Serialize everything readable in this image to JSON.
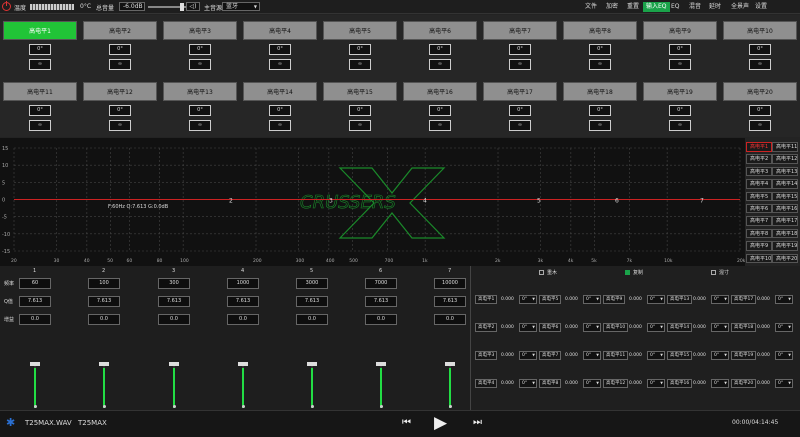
{
  "topbar": {
    "temp_label": "温度",
    "temp_value": "0°C",
    "volume_label": "总音量",
    "volume_value": "-6.0dB",
    "mute_label": "◁)",
    "source_label": "主音源",
    "source_value": "蓝牙",
    "menu": [
      "文件",
      "加密",
      "重置",
      "输入EQ",
      "EQ",
      "混音",
      "延时",
      "全景声",
      "设置"
    ],
    "active_menu": 3
  },
  "channels": [
    {
      "name": "高电平1",
      "phase": "0°",
      "link": "∞"
    },
    {
      "name": "高电平2",
      "phase": "0°",
      "link": "∞"
    },
    {
      "name": "高电平3",
      "phase": "0°",
      "link": "∞"
    },
    {
      "name": "高电平4",
      "phase": "0°",
      "link": "∞"
    },
    {
      "name": "高电平5",
      "phase": "0°",
      "link": "∞"
    },
    {
      "name": "高电平6",
      "phase": "0°",
      "link": "∞"
    },
    {
      "name": "高电平7",
      "phase": "0°",
      "link": "∞"
    },
    {
      "name": "高电平8",
      "phase": "0°",
      "link": "∞"
    },
    {
      "name": "高电平9",
      "phase": "0°",
      "link": "∞"
    },
    {
      "name": "高电平10",
      "phase": "0°",
      "link": "∞"
    },
    {
      "name": "高电平11",
      "phase": "0°",
      "link": "∞"
    },
    {
      "name": "高电平12",
      "phase": "0°",
      "link": "∞"
    },
    {
      "name": "高电平13",
      "phase": "0°",
      "link": "∞"
    },
    {
      "name": "高电平14",
      "phase": "0°",
      "link": "∞"
    },
    {
      "name": "高电平15",
      "phase": "0°",
      "link": "∞"
    },
    {
      "name": "高电平16",
      "phase": "0°",
      "link": "∞"
    },
    {
      "name": "高电平17",
      "phase": "0°",
      "link": "∞"
    },
    {
      "name": "高电平18",
      "phase": "0°",
      "link": "∞"
    },
    {
      "name": "高电平19",
      "phase": "0°",
      "link": "∞"
    },
    {
      "name": "高电平20",
      "phase": "0°",
      "link": "∞"
    }
  ],
  "graph": {
    "y_ticks": [
      "15",
      "10",
      "5",
      "0",
      "-5",
      "-10",
      "-15"
    ],
    "x_ticks": [
      "20",
      "30",
      "40",
      "50",
      "60",
      "80",
      "100",
      "200",
      "300",
      "400",
      "500",
      "700",
      "1k",
      "2k",
      "3k",
      "4k",
      "5k",
      "7k",
      "10k",
      "20k"
    ],
    "annotation": "F:60Hz Q:7.613 G:0.0dB",
    "point_labels": [
      "2",
      "3",
      "4",
      "5",
      "6",
      "7"
    ],
    "logo": "CRUSSERS",
    "curve_color": "#cc2222"
  },
  "right_list": [
    "高电平1",
    "高电平11",
    "高电平2",
    "高电平12",
    "高电平3",
    "高电平13",
    "高电平4",
    "高电平14",
    "高电平5",
    "高电平15",
    "高电平6",
    "高电平16",
    "高电平7",
    "高电平17",
    "高电平8",
    "高电平18",
    "高电平9",
    "高电平19",
    "高电平10",
    "高电平20"
  ],
  "bands": {
    "row_labels": [
      "频率",
      "Q值",
      "增益"
    ],
    "items": [
      {
        "num": "1",
        "freq": "60",
        "q": "7.613",
        "gain": "0.0"
      },
      {
        "num": "2",
        "freq": "100",
        "q": "7.613",
        "gain": "0.0"
      },
      {
        "num": "3",
        "freq": "300",
        "q": "7.613",
        "gain": "0.0"
      },
      {
        "num": "4",
        "freq": "1000",
        "q": "7.613",
        "gain": "0.0"
      },
      {
        "num": "5",
        "freq": "3000",
        "q": "7.613",
        "gain": "0.0"
      },
      {
        "num": "6",
        "freq": "7000",
        "q": "7.613",
        "gain": "0.0"
      },
      {
        "num": "7",
        "freq": "10000",
        "q": "7.613",
        "gain": "0.0"
      }
    ]
  },
  "mix": {
    "options": [
      "重木",
      "复制",
      "混寸"
    ],
    "checked": 1,
    "val": "0.000",
    "unit": "0°",
    "grid": [
      [
        "高电平1",
        "高电平5",
        "高电平9",
        "高电平13",
        "高电平17"
      ],
      [
        "高电平2",
        "高电平6",
        "高电平10",
        "高电平14",
        "高电平18"
      ],
      [
        "高电平3",
        "高电平7",
        "高电平11",
        "高电平15",
        "高电平19"
      ],
      [
        "高电平4",
        "高电平8",
        "高电平12",
        "高电平16",
        "高电平20"
      ]
    ]
  },
  "player": {
    "file": "T25MAX.WAV",
    "device": "T25MAX",
    "time": "00:00/04:14:45"
  }
}
